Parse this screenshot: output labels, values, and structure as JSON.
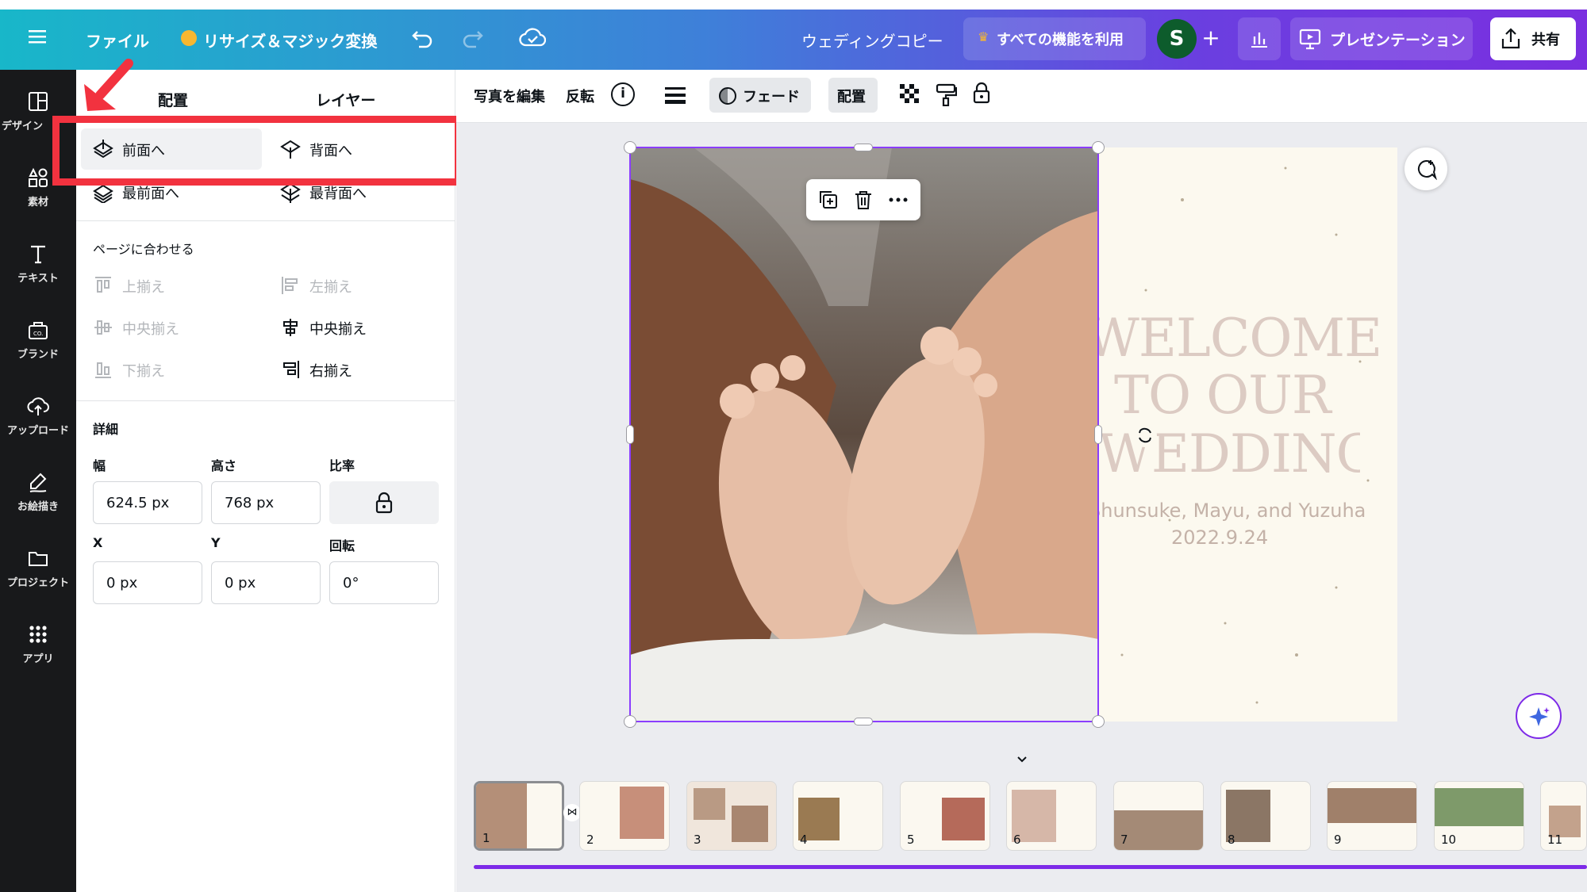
{
  "topbar": {
    "file_label": "ファイル",
    "resize_label": "リサイズ＆マジック変換",
    "doc_title": "ウェディングコピー",
    "pro_label": "すべての機能を利用",
    "avatar_letter": "S",
    "add_label": "+",
    "present_label": "プレゼンテーション",
    "share_label": "共有"
  },
  "rail": {
    "items": [
      {
        "label": "デザイン",
        "icon": "layout-icon"
      },
      {
        "label": "素材",
        "icon": "elements-icon"
      },
      {
        "label": "テキスト",
        "icon": "text-icon"
      },
      {
        "label": "ブランド",
        "icon": "brand-icon"
      },
      {
        "label": "アップロード",
        "icon": "upload-icon"
      },
      {
        "label": "お絵描き",
        "icon": "draw-icon"
      },
      {
        "label": "プロジェクト",
        "icon": "folder-icon"
      },
      {
        "label": "アプリ",
        "icon": "apps-icon"
      }
    ]
  },
  "panel": {
    "tab_arrange": "配置",
    "tab_layers": "レイヤー",
    "forward": "前面へ",
    "backward": "背面へ",
    "to_front": "最前面へ",
    "to_back": "最背面へ",
    "fit_page": "ページに合わせる",
    "align_top": "上揃え",
    "align_left": "左揃え",
    "align_middle": "中央揃え",
    "align_center": "中央揃え",
    "align_bottom": "下揃え",
    "align_right": "右揃え",
    "details": "詳細",
    "width_label": "幅",
    "height_label": "高さ",
    "ratio_label": "比率",
    "width_value": "624.5 px",
    "height_value": "768 px",
    "x_label": "X",
    "y_label": "Y",
    "rotation_label": "回転",
    "x_value": "0 px",
    "y_value": "0 px",
    "rotation_value": "0°"
  },
  "toolbar": {
    "edit_photo": "写真を編集",
    "flip": "反転",
    "fade": "フェード",
    "arrange": "配置"
  },
  "slide": {
    "line1": "WELCOME",
    "line2": "TO OUR",
    "line3": "WEDDING",
    "names": "Shunsuke, Mayu, and Yuzuha",
    "date": "2022.9.24"
  },
  "pages": [
    "1",
    "2",
    "3",
    "4",
    "5",
    "6",
    "7",
    "8",
    "9",
    "10",
    "11"
  ],
  "colors": {
    "accent": "#7d2ae8",
    "highlight": "#f2323f",
    "slide_text": "#d9c4bb"
  }
}
